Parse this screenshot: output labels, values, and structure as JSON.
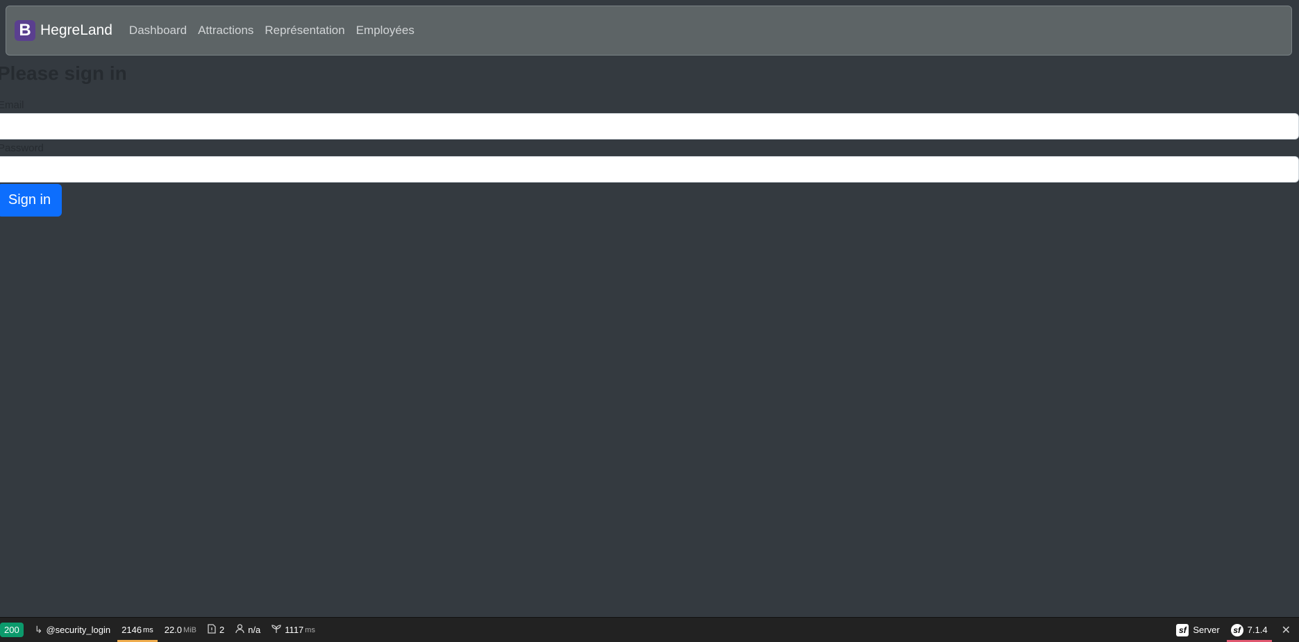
{
  "navbar": {
    "brand_letter": "B",
    "brand_name": "HegreLand",
    "links": [
      "Dashboard",
      "Attractions",
      "Représentation",
      "Employées"
    ]
  },
  "form": {
    "title": "Please sign in",
    "email_label": "Email",
    "email_value": "",
    "password_label": "Password",
    "password_value": "",
    "submit_label": "Sign in"
  },
  "colors": {
    "background": "#343a40",
    "navbar": "#5d6466",
    "primary": "#0d6efd",
    "status_ok": "#0c9a6c"
  },
  "debug_toolbar": {
    "status_code": "200",
    "route": "@security_login",
    "time_value": "2146",
    "time_unit": "ms",
    "memory_value": "22.0",
    "memory_unit": "MiB",
    "logs_count": "2",
    "user": "n/a",
    "twig_value": "1117",
    "twig_unit": "ms",
    "server_label": "Server",
    "version": "7.1.4",
    "symfony_glyph": "sf"
  }
}
